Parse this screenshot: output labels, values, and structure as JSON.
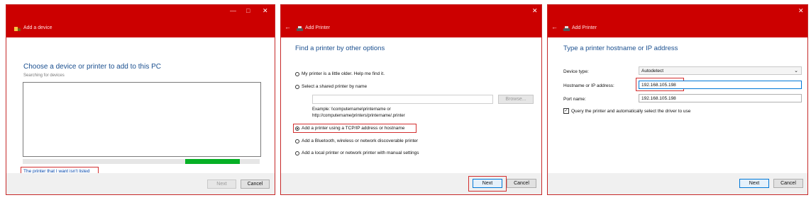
{
  "windows": [
    {
      "title": "Add a device",
      "heading": "Choose a device or printer to add to this PC",
      "subheading": "Searching for devices",
      "link": "The printer that I want isn't listed",
      "next": "Next",
      "cancel": "Cancel",
      "progress": 0.23,
      "controls": {
        "minimize": "—",
        "maximize": "□",
        "close": "✕"
      }
    },
    {
      "title": "Add Printer",
      "heading": "Find a printer by other options",
      "options": [
        "My printer is a little older. Help me find it.",
        "Select a shared printer by name",
        "Add a printer using a TCP/IP address or hostname",
        "Add a Bluetooth, wireless or network discoverable printer",
        "Add a local printer or network printer with manual settings"
      ],
      "selected_option": 2,
      "browse": "Browse...",
      "example_line1": "Example: \\\\computername\\printername or",
      "example_line2": "http://computername/printers/printername/.printer",
      "next": "Next",
      "cancel": "Cancel",
      "close": "✕",
      "back": "←"
    },
    {
      "title": "Add Printer",
      "heading": "Type a printer hostname or IP address",
      "device_type_label": "Device type:",
      "device_type_value": "Autodetect",
      "hostname_label": "Hostname or IP address:",
      "hostname_value": "192.168.105.198",
      "port_label": "Port name:",
      "port_value": "192.168.105.198",
      "query_label": "Query the printer and automatically select the driver to use",
      "query_checked": true,
      "next": "Next",
      "cancel": "Cancel",
      "close": "✕",
      "back": "←"
    }
  ]
}
